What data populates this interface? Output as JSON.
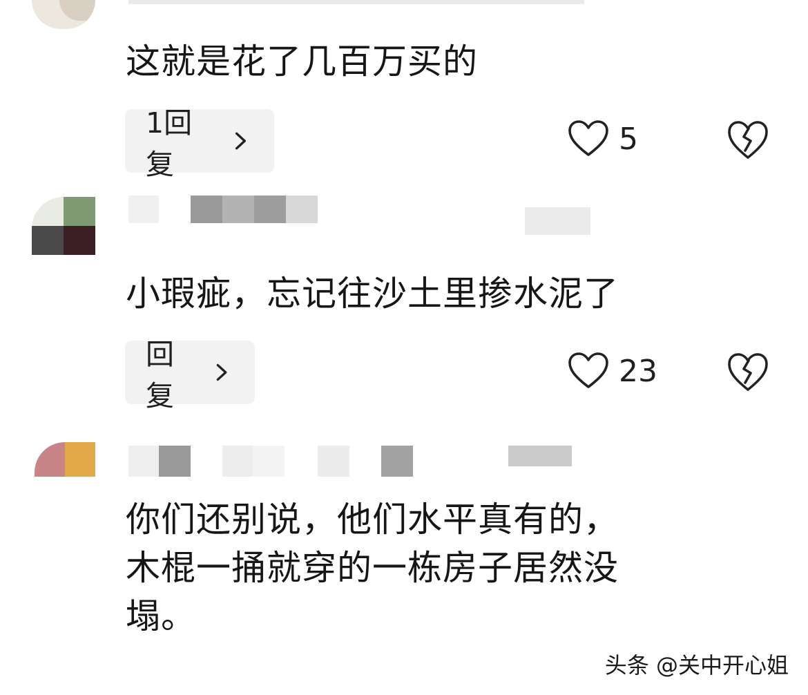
{
  "comments": [
    {
      "text": "这就是花了几百万买的",
      "reply_label": "1回复",
      "likes": "5",
      "icons": {
        "like": "heart-outline-icon",
        "dislike": "broken-heart-icon",
        "chevron": "chevron-right-icon"
      }
    },
    {
      "text": "小瑕疵，忘记往沙土里掺水泥了",
      "reply_label": "回复",
      "likes": "23",
      "icons": {
        "like": "heart-outline-icon",
        "dislike": "broken-heart-icon",
        "chevron": "chevron-right-icon"
      }
    },
    {
      "text_line1": "你们还别说，他们水平真有的，",
      "text_line2": "木棍一捅就穿的一栋房子居然没",
      "text_line3": "塌。"
    }
  ],
  "watermark": "头条 @关中开心姐",
  "colors": {
    "pill_bg": "#f2f2f2",
    "text": "#161616",
    "blur_gray": "#9a9a9a"
  }
}
